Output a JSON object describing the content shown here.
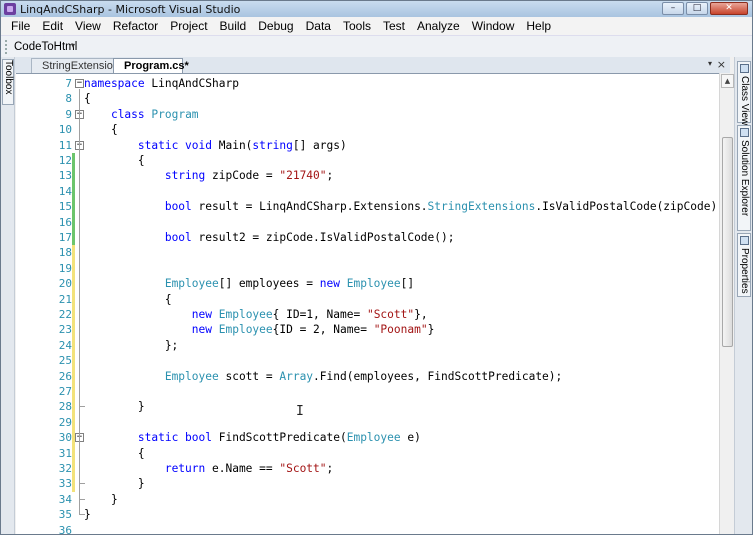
{
  "window": {
    "title": "LinqAndCSharp - Microsoft Visual Studio",
    "controls": [
      "–",
      "□",
      "✕"
    ]
  },
  "menu": [
    "File",
    "Edit",
    "View",
    "Refactor",
    "Project",
    "Build",
    "Debug",
    "Data",
    "Tools",
    "Test",
    "Analyze",
    "Window",
    "Help"
  ],
  "toolbar": {
    "button_label": "CodeToHtml"
  },
  "tabs": [
    {
      "label": "StringExtensions.cs",
      "active": false
    },
    {
      "label": "Program.cs*",
      "active": true
    }
  ],
  "side_panels": {
    "left": [
      "Toolbox"
    ],
    "right": [
      "Class View",
      "Solution Explorer",
      "Properties"
    ]
  },
  "editor": {
    "lines": [
      {
        "n": "7",
        "change": "",
        "fold": "minus",
        "seg": [
          [
            "kw",
            "namespace"
          ],
          [
            "",
            "LinqAndCSharp"
          ]
        ]
      },
      {
        "n": "8",
        "change": "",
        "fold": "",
        "seg": [
          [
            "",
            "{"
          ]
        ]
      },
      {
        "n": "9",
        "change": "",
        "fold": "minus",
        "seg": [
          [
            "",
            "    "
          ],
          [
            "kw",
            "class"
          ],
          [
            "",
            ""
          ],
          [
            "ty",
            "Program"
          ]
        ]
      },
      {
        "n": "10",
        "change": "",
        "fold": "",
        "seg": [
          [
            "",
            "    {"
          ]
        ]
      },
      {
        "n": "11",
        "change": "",
        "fold": "minus",
        "seg": [
          [
            "",
            "        "
          ],
          [
            "kw",
            "static void"
          ],
          [
            "",
            "Main("
          ],
          [
            "kw",
            "string"
          ],
          [
            "",
            "[] args)"
          ]
        ]
      },
      {
        "n": "12",
        "change": "g",
        "fold": "",
        "seg": [
          [
            "",
            "        {"
          ]
        ]
      },
      {
        "n": "13",
        "change": "g",
        "fold": "",
        "seg": [
          [
            "",
            "            "
          ],
          [
            "kw",
            "string"
          ],
          [
            "",
            "zipCode = "
          ],
          [
            "str",
            "\"21740\""
          ],
          [
            "",
            ";"
          ]
        ]
      },
      {
        "n": "14",
        "change": "g",
        "fold": "",
        "seg": []
      },
      {
        "n": "15",
        "change": "g",
        "fold": "",
        "seg": [
          [
            "",
            "            "
          ],
          [
            "kw",
            "bool"
          ],
          [
            "",
            "result = LinqAndCSharp.Extensions."
          ],
          [
            "ty",
            "StringExtensions"
          ],
          [
            "",
            ".IsValidPostalCode(zipCode);"
          ]
        ]
      },
      {
        "n": "16",
        "change": "g",
        "fold": "",
        "seg": []
      },
      {
        "n": "17",
        "change": "g",
        "fold": "",
        "seg": [
          [
            "",
            "            "
          ],
          [
            "kw",
            "bool"
          ],
          [
            "",
            "result2 = zipCode.IsValidPostalCode();"
          ]
        ]
      },
      {
        "n": "18",
        "change": "y",
        "fold": "",
        "seg": []
      },
      {
        "n": "19",
        "change": "y",
        "fold": "",
        "seg": []
      },
      {
        "n": "20",
        "change": "y",
        "fold": "",
        "seg": [
          [
            "",
            "            "
          ],
          [
            "ty",
            "Employee"
          ],
          [
            "",
            "[] employees = "
          ],
          [
            "kw",
            "new"
          ],
          [
            "",
            ""
          ],
          [
            "ty",
            "Employee"
          ],
          [
            "",
            "[]"
          ]
        ]
      },
      {
        "n": "21",
        "change": "y",
        "fold": "",
        "seg": [
          [
            "",
            "            {"
          ]
        ]
      },
      {
        "n": "22",
        "change": "y",
        "fold": "",
        "seg": [
          [
            "",
            "                "
          ],
          [
            "kw",
            "new"
          ],
          [
            "",
            ""
          ],
          [
            "ty",
            "Employee"
          ],
          [
            "",
            "{ ID=1, Name="
          ],
          [
            "str",
            "\"Scott\""
          ],
          [
            "",
            "},"
          ]
        ]
      },
      {
        "n": "23",
        "change": "y",
        "fold": "",
        "seg": [
          [
            "",
            "                "
          ],
          [
            "kw",
            "new"
          ],
          [
            "",
            ""
          ],
          [
            "ty",
            "Employee"
          ],
          [
            "",
            "{ID = 2, Name="
          ],
          [
            "str",
            "\"Poonam\""
          ],
          [
            "",
            "}"
          ]
        ]
      },
      {
        "n": "24",
        "change": "y",
        "fold": "",
        "seg": [
          [
            "",
            "            };"
          ]
        ]
      },
      {
        "n": "25",
        "change": "y",
        "fold": "",
        "seg": []
      },
      {
        "n": "26",
        "change": "y",
        "fold": "",
        "seg": [
          [
            "",
            "            "
          ],
          [
            "ty",
            "Employee"
          ],
          [
            "",
            "scott = "
          ],
          [
            "ty",
            "Array"
          ],
          [
            "",
            ".Find(employees, FindScottPredicate);"
          ]
        ]
      },
      {
        "n": "27",
        "change": "y",
        "fold": "",
        "seg": []
      },
      {
        "n": "28",
        "change": "y",
        "fold": "end",
        "seg": [
          [
            "",
            "        }"
          ]
        ]
      },
      {
        "n": "29",
        "change": "y",
        "fold": "",
        "seg": []
      },
      {
        "n": "30",
        "change": "y",
        "fold": "minus",
        "seg": [
          [
            "",
            "        "
          ],
          [
            "kw",
            "static bool"
          ],
          [
            "",
            "FindScottPredicate("
          ],
          [
            "ty",
            "Employee"
          ],
          [
            "",
            "e)"
          ]
        ]
      },
      {
        "n": "31",
        "change": "y",
        "fold": "",
        "seg": [
          [
            "",
            "        {"
          ]
        ]
      },
      {
        "n": "32",
        "change": "y",
        "fold": "",
        "seg": [
          [
            "",
            "            "
          ],
          [
            "kw",
            "return"
          ],
          [
            "",
            "e.Name == "
          ],
          [
            "str",
            "\"Scott\""
          ],
          [
            "",
            ";"
          ]
        ]
      },
      {
        "n": "33",
        "change": "y",
        "fold": "end",
        "seg": [
          [
            "",
            "        }"
          ]
        ]
      },
      {
        "n": "34",
        "change": "",
        "fold": "end",
        "seg": [
          [
            "",
            "    }"
          ]
        ]
      },
      {
        "n": "35",
        "change": "",
        "fold": "end",
        "seg": [
          [
            "",
            "}"
          ]
        ]
      },
      {
        "n": "36",
        "change": "",
        "fold": "",
        "seg": []
      }
    ]
  },
  "colors": {
    "keyword": "#0000ff",
    "type": "#2b91af",
    "string": "#a31515",
    "line_number": "#2b91af",
    "change_saved": "#6cc56c",
    "change_unsaved": "#f3e27a"
  }
}
